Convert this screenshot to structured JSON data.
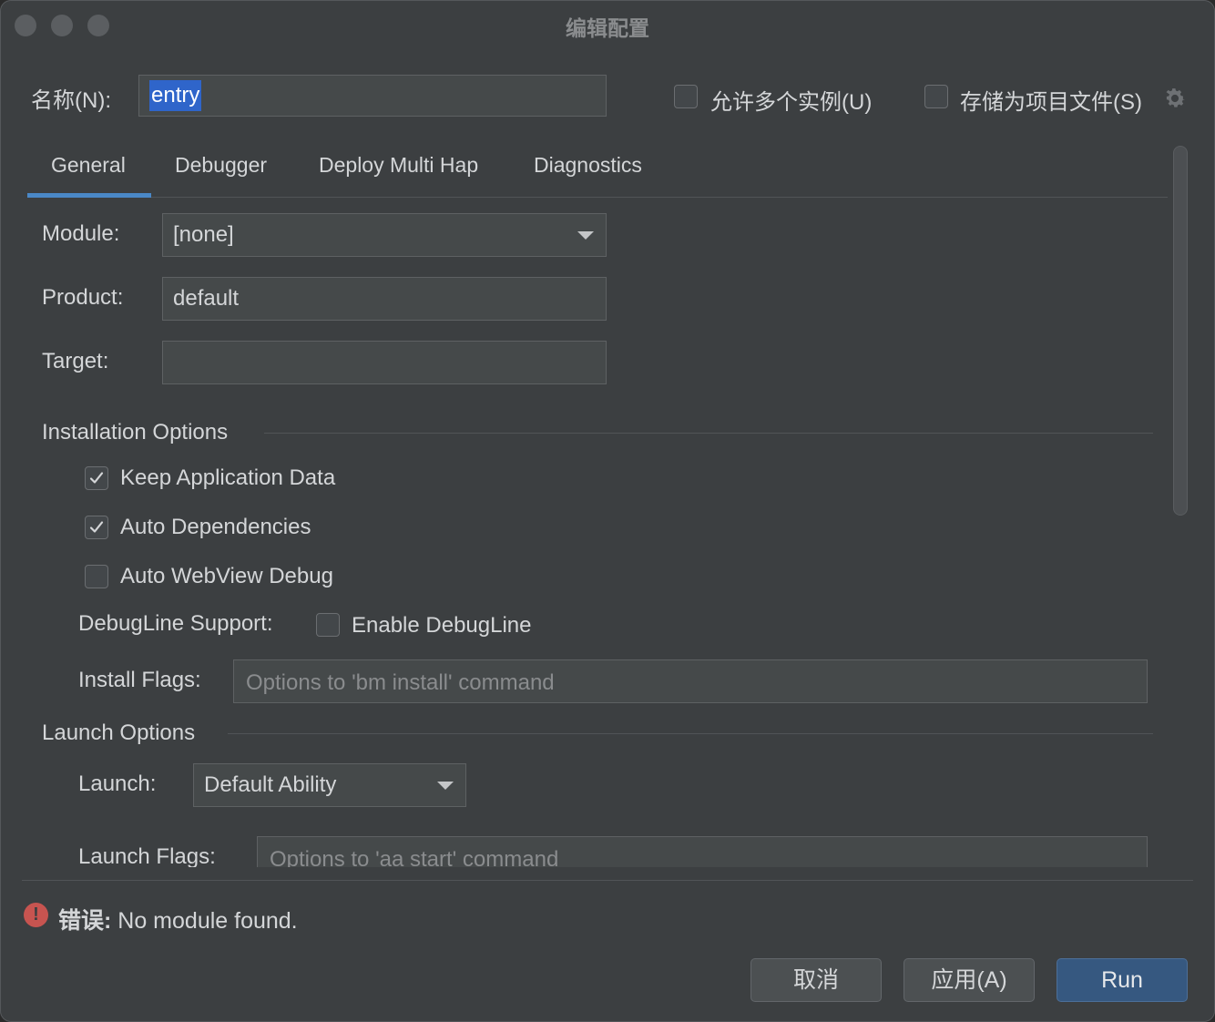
{
  "window": {
    "title": "编辑配置"
  },
  "header": {
    "name_label": "名称(N):",
    "name_value": "entry",
    "allow_multiple_label": "允许多个实例(U)",
    "allow_multiple_checked": false,
    "store_as_project_label": "存储为项目文件(S)",
    "store_as_project_checked": false
  },
  "tabs": [
    {
      "label": "General",
      "active": true
    },
    {
      "label": "Debugger",
      "active": false
    },
    {
      "label": "Deploy Multi Hap",
      "active": false
    },
    {
      "label": "Diagnostics",
      "active": false
    }
  ],
  "general": {
    "module_label": "Module:",
    "module_value": "[none]",
    "product_label": "Product:",
    "product_value": "default",
    "target_label": "Target:",
    "target_value": ""
  },
  "installation": {
    "title": "Installation Options",
    "keep_app_data": {
      "label": "Keep Application Data",
      "checked": true
    },
    "auto_dependencies": {
      "label": "Auto Dependencies",
      "checked": true
    },
    "auto_webview_debug": {
      "label": "Auto WebView Debug",
      "checked": false
    },
    "debugline_label": "DebugLine Support:",
    "enable_debugline": {
      "label": "Enable DebugLine",
      "checked": false
    },
    "install_flags_label": "Install Flags:",
    "install_flags_placeholder": "Options to 'bm install' command"
  },
  "launch": {
    "title": "Launch Options",
    "launch_label": "Launch:",
    "launch_value": "Default Ability",
    "launch_flags_label": "Launch Flags:",
    "launch_flags_placeholder": "Options to 'aa start' command"
  },
  "status": {
    "error_prefix": "错误:",
    "error_message": "No module found."
  },
  "buttons": {
    "cancel": "取消",
    "apply": "应用(A)",
    "run": "Run"
  },
  "colors": {
    "background": "#3c3f41",
    "selection": "#2f65ca",
    "tab_underline": "#4a88c7",
    "primary_button": "#365880",
    "error": "#c75450"
  }
}
